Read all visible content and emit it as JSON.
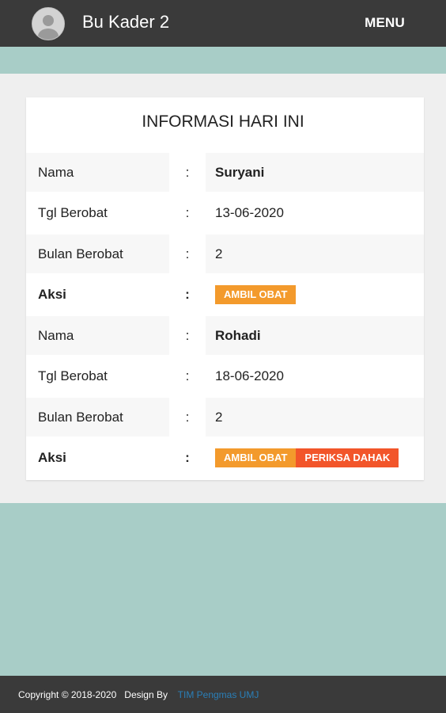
{
  "header": {
    "title": "Bu Kader 2",
    "menu_label": "MENU"
  },
  "card": {
    "title": "INFORMASI HARI INI",
    "separator": ":",
    "entries": [
      {
        "nama_label": "Nama",
        "nama_value": "Suryani",
        "tgl_label": "Tgl Berobat",
        "tgl_value": "13-06-2020",
        "bulan_label": "Bulan Berobat",
        "bulan_value": "2",
        "aksi_label": "Aksi",
        "buttons": [
          "AMBIL OBAT"
        ]
      },
      {
        "nama_label": "Nama",
        "nama_value": "Rohadi",
        "tgl_label": "Tgl Berobat",
        "tgl_value": "18-06-2020",
        "bulan_label": "Bulan Berobat",
        "bulan_value": "2",
        "aksi_label": "Aksi",
        "buttons": [
          "AMBIL OBAT",
          "PERIKSA DAHAK"
        ]
      }
    ]
  },
  "footer": {
    "copyright": "Copyright © 2018-2020",
    "design_by": "Design By",
    "link_text": "TIM Pengmas UMJ"
  },
  "colors": {
    "topbar": "#3a3a3a",
    "teal": "#a8cdc7",
    "orange_button": "#f39a2c",
    "red_button": "#f2552a",
    "link": "#2a7fb8"
  }
}
